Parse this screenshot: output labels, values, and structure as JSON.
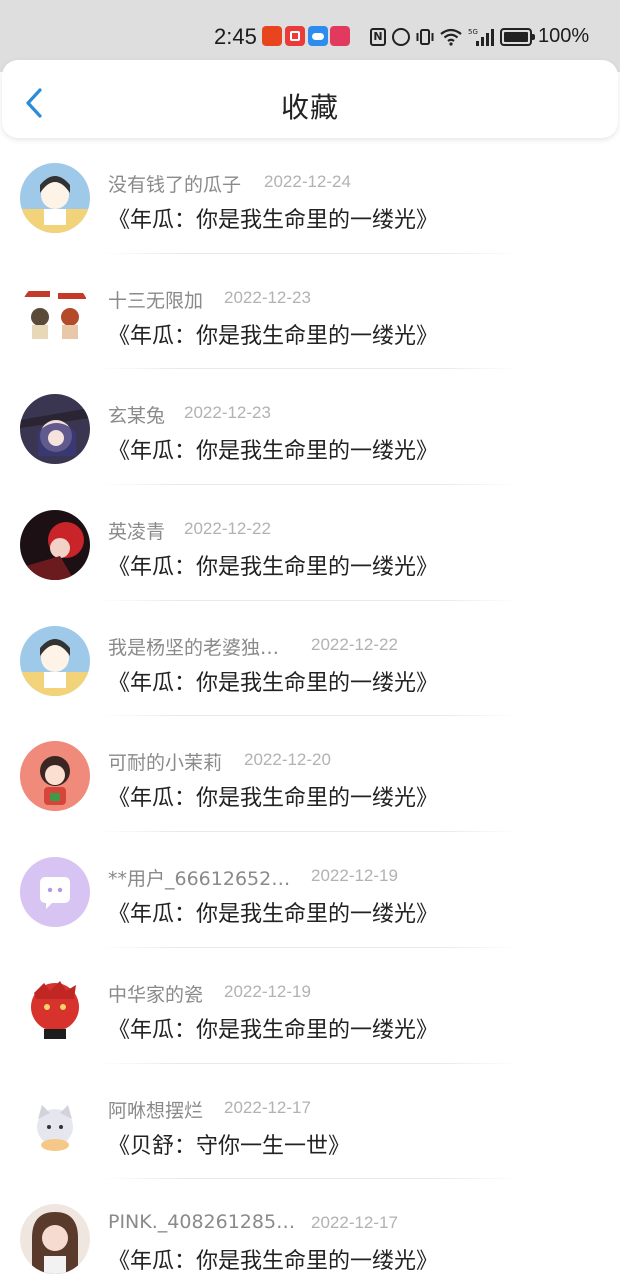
{
  "status_bar": {
    "time": "2:45",
    "battery_text": "100%",
    "signal_label": "5G",
    "app_icons": [
      "taobao-icon",
      "red-app-icon",
      "cloud-icon",
      "shop-icon"
    ],
    "system_icons": [
      "nfc-icon",
      "alarm-icon",
      "vibrate-icon",
      "wifi-icon",
      "signal-icon",
      "battery-icon"
    ]
  },
  "header": {
    "title": "收藏",
    "back_icon": "chevron-left-icon",
    "accent_color": "#2a8bd8"
  },
  "favorites": [
    {
      "name": "没有钱了的瓜子",
      "date": "2022-12-24",
      "title": "《年瓜：你是我生命里的一缕光》"
    },
    {
      "name": "十三无限加",
      "date": "2022-12-23",
      "title": "《年瓜：你是我生命里的一缕光》"
    },
    {
      "name": "玄某兔",
      "date": "2022-12-23",
      "title": "《年瓜：你是我生命里的一缕光》"
    },
    {
      "name": "英凌青",
      "date": "2022-12-22",
      "title": "《年瓜：你是我生命里的一缕光》"
    },
    {
      "name": "我是杨坚的老婆独…",
      "date": "2022-12-22",
      "title": "《年瓜：你是我生命里的一缕光》"
    },
    {
      "name": "可耐的小茉莉",
      "date": "2022-12-20",
      "title": "《年瓜：你是我生命里的一缕光》"
    },
    {
      "name": "**用户_66612652…",
      "date": "2022-12-19",
      "title": "《年瓜：你是我生命里的一缕光》"
    },
    {
      "name": "中华家的瓷",
      "date": "2022-12-19",
      "title": "《年瓜：你是我生命里的一缕光》"
    },
    {
      "name": "阿咻想摆烂",
      "date": "2022-12-17",
      "title": "《贝舒：守你一生一世》"
    },
    {
      "name": "PINK._408261285…",
      "date": "2022-12-17",
      "title": "《年瓜：你是我生命里的一缕光》"
    }
  ]
}
